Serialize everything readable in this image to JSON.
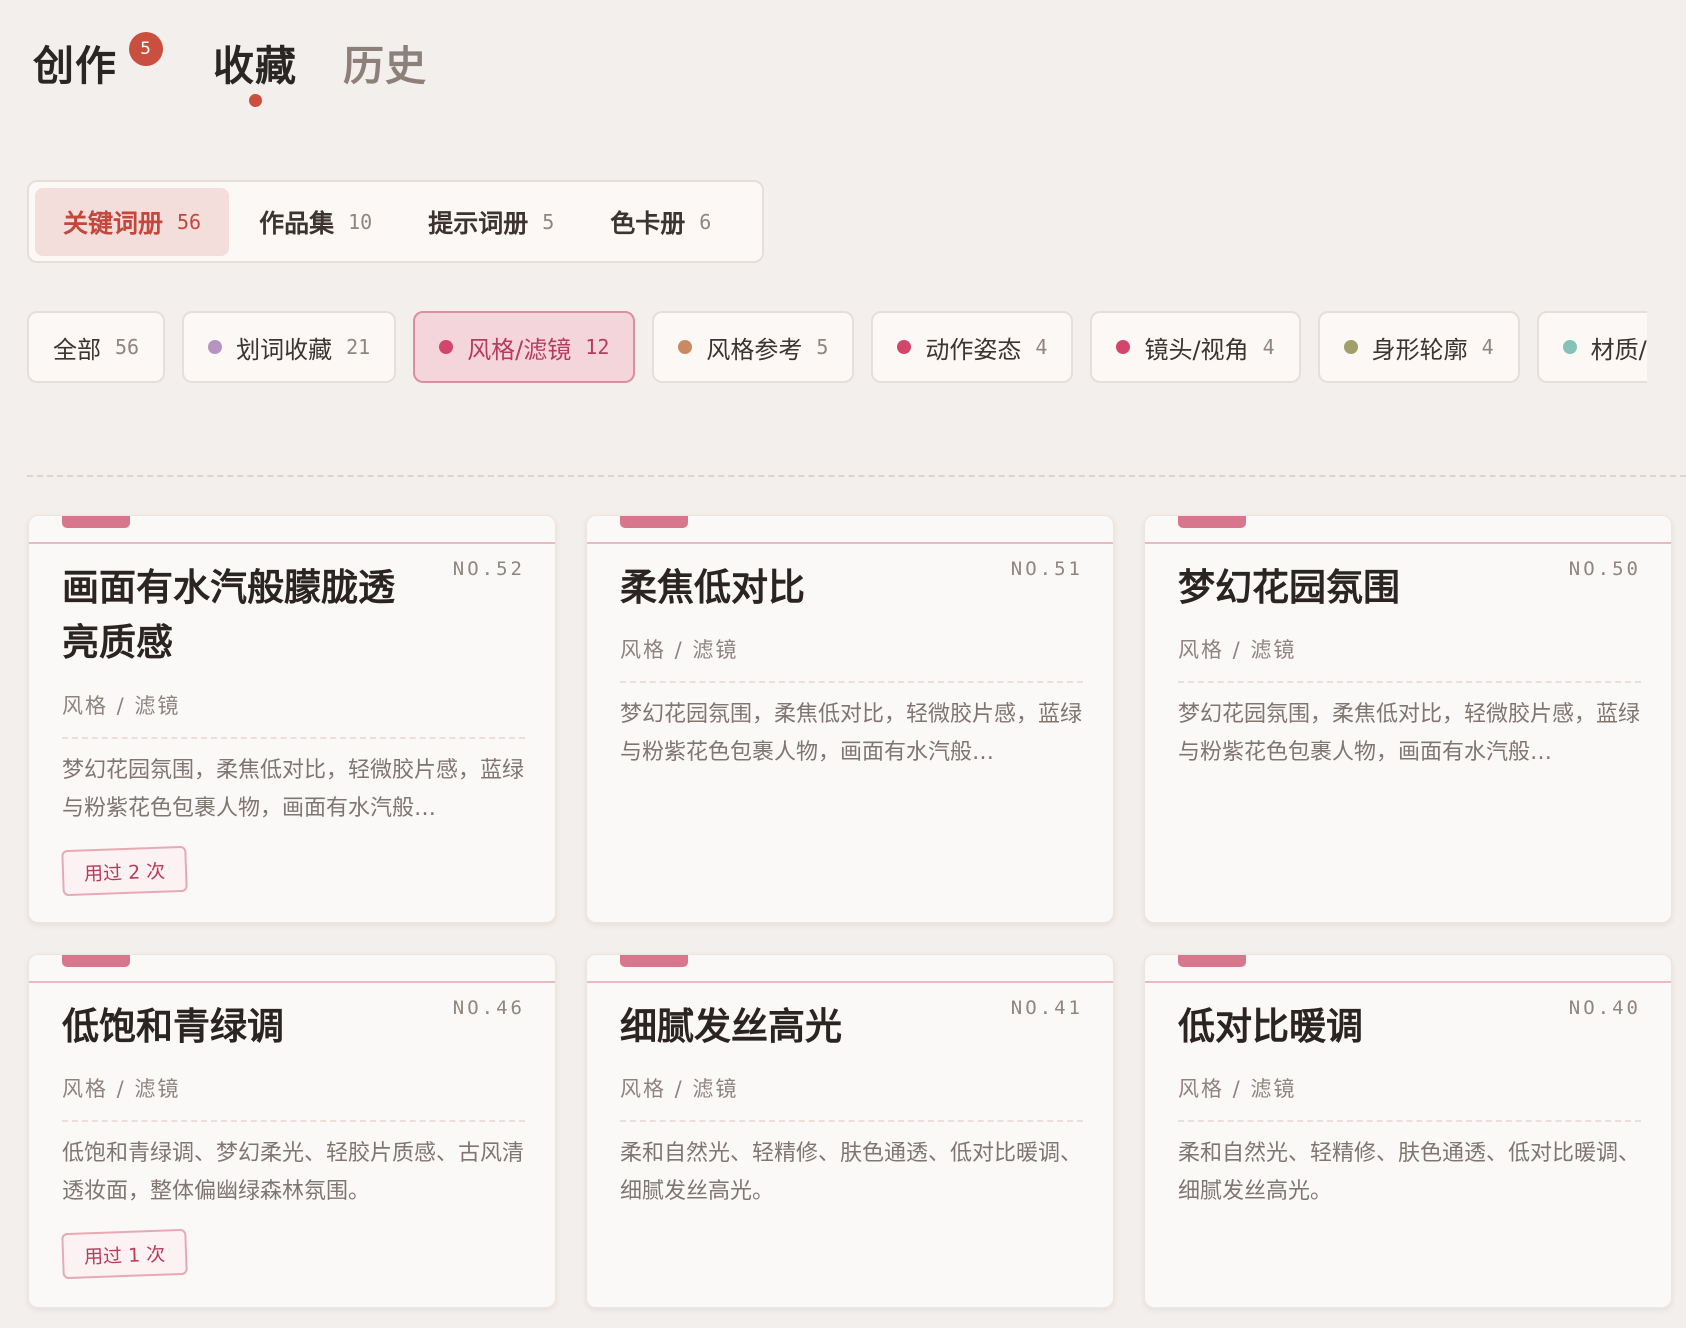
{
  "main_tabs": [
    {
      "label": "创作",
      "badge": "5"
    },
    {
      "label": "收藏"
    },
    {
      "label": "历史"
    }
  ],
  "sub_tabs": [
    {
      "label": "关键词册",
      "count": "56"
    },
    {
      "label": "作品集",
      "count": "10"
    },
    {
      "label": "提示词册",
      "count": "5"
    },
    {
      "label": "色卡册",
      "count": "6"
    }
  ],
  "filters": [
    {
      "label": "全部",
      "count": "56"
    },
    {
      "label": "划词收藏",
      "count": "21",
      "color": "#b594c1"
    },
    {
      "label": "风格/滤镜",
      "count": "12",
      "color": "#d1466a"
    },
    {
      "label": "风格参考",
      "count": "5",
      "color": "#c98a63"
    },
    {
      "label": "动作姿态",
      "count": "4",
      "color": "#d1466a"
    },
    {
      "label": "镜头/视角",
      "count": "4",
      "color": "#d1466a"
    },
    {
      "label": "身形轮廓",
      "count": "4",
      "color": "#a0a068"
    },
    {
      "label": "材质/",
      "color": "#86c2b6"
    }
  ],
  "cards": [
    {
      "no": "NO.52",
      "title": "画面有水汽般朦胧透亮质感",
      "category": "风格 / 滤镜",
      "desc": "梦幻花园氛围，柔焦低对比，轻微胶片感，蓝绿与粉紫花色包裹人物，画面有水汽般…",
      "used": "用过 2 次"
    },
    {
      "no": "NO.51",
      "title": "柔焦低对比",
      "category": "风格 / 滤镜",
      "desc": "梦幻花园氛围，柔焦低对比，轻微胶片感，蓝绿与粉紫花色包裹人物，画面有水汽般…"
    },
    {
      "no": "NO.50",
      "title": "梦幻花园氛围",
      "category": "风格 / 滤镜",
      "desc": "梦幻花园氛围，柔焦低对比，轻微胶片感，蓝绿与粉紫花色包裹人物，画面有水汽般…"
    },
    {
      "no": "NO.46",
      "title": "低饱和青绿调",
      "category": "风格 / 滤镜",
      "desc": "低饱和青绿调、梦幻柔光、轻胶片质感、古风清透妆面，整体偏幽绿森林氛围。",
      "used": "用过 1 次"
    },
    {
      "no": "NO.41",
      "title": "细腻发丝高光",
      "category": "风格 / 滤镜",
      "desc": "柔和自然光、轻精修、肤色通透、低对比暖调、细腻发丝高光。"
    },
    {
      "no": "NO.40",
      "title": "低对比暖调",
      "category": "风格 / 滤镜",
      "desc": "柔和自然光、轻精修、肤色通透、低对比暖调、细腻发丝高光。"
    }
  ]
}
